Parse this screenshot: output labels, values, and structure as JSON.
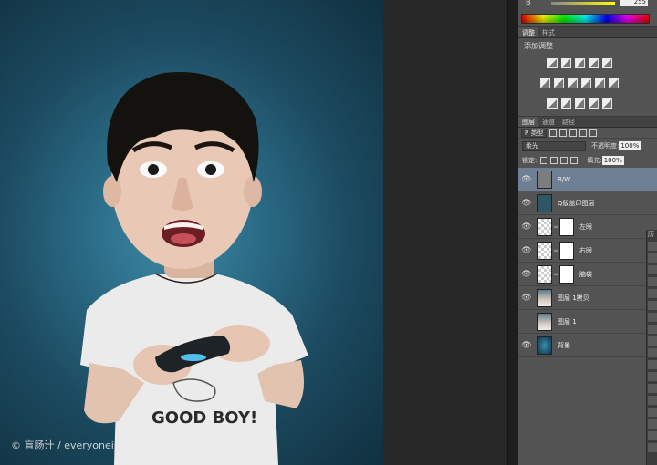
{
  "canvas": {
    "watermark": "© 盲肠汁 / everyoneisaprecioner.com"
  },
  "color_panel": {
    "channel_label": "B",
    "channel_value": "255"
  },
  "adjustments": {
    "tabs": [
      "调整",
      "样式"
    ],
    "title": "添加调整"
  },
  "layers_panel": {
    "tabs": [
      "图层",
      "通道",
      "路径"
    ],
    "kind_filter": "P 类型",
    "blend_mode": "柔光",
    "opacity_label": "不透明度:",
    "opacity_value": "100%",
    "lock_label": "锁定:",
    "fill_label": "填充:",
    "fill_value": "100%",
    "layers": [
      {
        "name": "B/W",
        "visible": true,
        "selected": true
      },
      {
        "name": "Q版盖印图层",
        "visible": true,
        "selected": false
      },
      {
        "name": "左眼",
        "visible": true,
        "selected": false
      },
      {
        "name": "右眼",
        "visible": true,
        "selected": false
      },
      {
        "name": "脑袋",
        "visible": true,
        "selected": false
      },
      {
        "name": "图层 1拷贝",
        "visible": true,
        "selected": false
      },
      {
        "name": "图层 1",
        "visible": false,
        "selected": false
      },
      {
        "name": "背景",
        "visible": true,
        "selected": false
      }
    ]
  },
  "side_strip": {
    "tab": "历"
  }
}
